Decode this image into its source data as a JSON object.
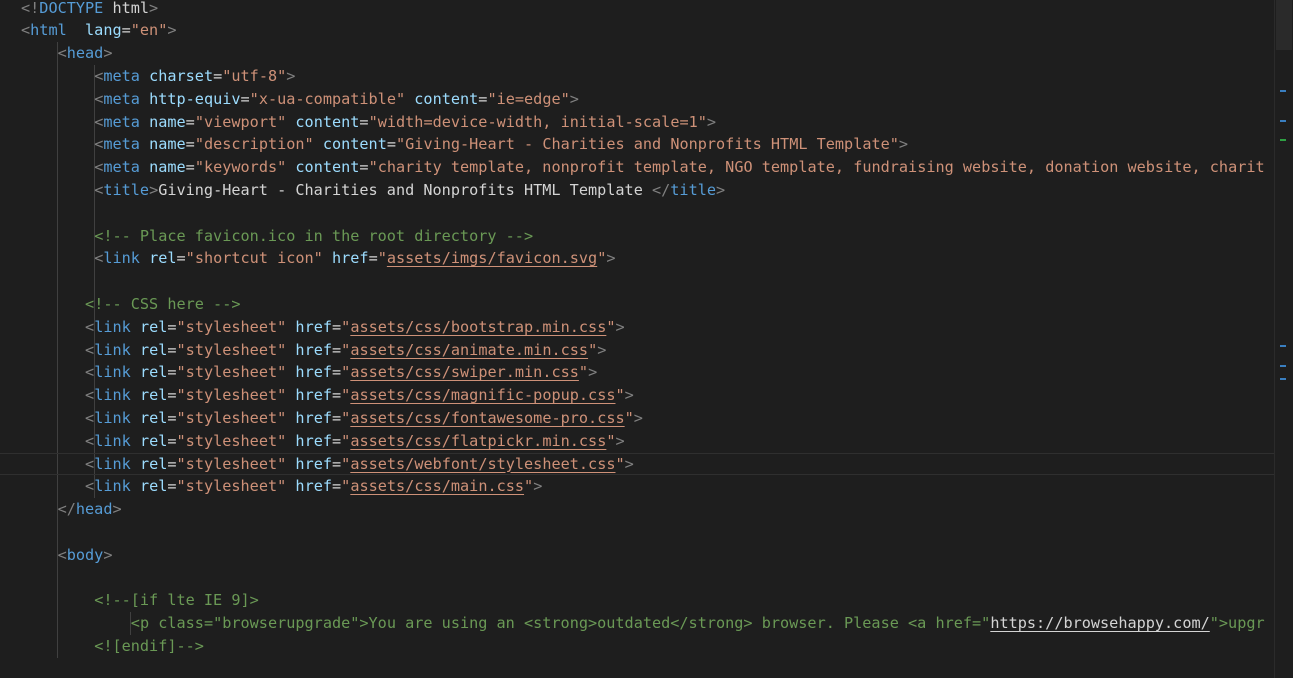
{
  "editor": {
    "current_line": 20,
    "colors": {
      "background": "#1e1e1e",
      "punctuation": "#808080",
      "tag": "#569cd6",
      "attribute": "#9cdcfe",
      "string": "#ce9178",
      "text": "#d4d4d4",
      "comment": "#6a9955"
    },
    "lines": [
      {
        "indent": 0,
        "tokens": [
          [
            "punct",
            "<!"
          ],
          [
            "kw",
            "DOCTYPE"
          ],
          [
            "text",
            " "
          ],
          [
            "docname",
            "html"
          ],
          [
            "punct",
            ">"
          ]
        ]
      },
      {
        "indent": 0,
        "tokens": [
          [
            "punct",
            "<"
          ],
          [
            "tag",
            "html"
          ],
          [
            "text",
            "  "
          ],
          [
            "attr",
            "lang"
          ],
          [
            "text",
            "="
          ],
          [
            "str",
            "\"en\""
          ],
          [
            "punct",
            ">"
          ]
        ]
      },
      {
        "indent": 4,
        "tokens": [
          [
            "punct",
            "<"
          ],
          [
            "tag",
            "head"
          ],
          [
            "punct",
            ">"
          ]
        ]
      },
      {
        "indent": 8,
        "tokens": [
          [
            "punct",
            "<"
          ],
          [
            "tag",
            "meta"
          ],
          [
            "text",
            " "
          ],
          [
            "attr",
            "charset"
          ],
          [
            "text",
            "="
          ],
          [
            "str",
            "\"utf-8\""
          ],
          [
            "punct",
            ">"
          ]
        ]
      },
      {
        "indent": 8,
        "tokens": [
          [
            "punct",
            "<"
          ],
          [
            "tag",
            "meta"
          ],
          [
            "text",
            " "
          ],
          [
            "attr",
            "http-equiv"
          ],
          [
            "text",
            "="
          ],
          [
            "str",
            "\"x-ua-compatible\""
          ],
          [
            "text",
            " "
          ],
          [
            "attr",
            "content"
          ],
          [
            "text",
            "="
          ],
          [
            "str",
            "\"ie=edge\""
          ],
          [
            "punct",
            ">"
          ]
        ]
      },
      {
        "indent": 8,
        "tokens": [
          [
            "punct",
            "<"
          ],
          [
            "tag",
            "meta"
          ],
          [
            "text",
            " "
          ],
          [
            "attr",
            "name"
          ],
          [
            "text",
            "="
          ],
          [
            "str",
            "\"viewport\""
          ],
          [
            "text",
            " "
          ],
          [
            "attr",
            "content"
          ],
          [
            "text",
            "="
          ],
          [
            "str",
            "\"width=device-width, initial-scale=1\""
          ],
          [
            "punct",
            ">"
          ]
        ]
      },
      {
        "indent": 8,
        "tokens": [
          [
            "punct",
            "<"
          ],
          [
            "tag",
            "meta"
          ],
          [
            "text",
            " "
          ],
          [
            "attr",
            "name"
          ],
          [
            "text",
            "="
          ],
          [
            "str",
            "\"description\""
          ],
          [
            "text",
            " "
          ],
          [
            "attr",
            "content"
          ],
          [
            "text",
            "="
          ],
          [
            "str",
            "\"Giving-Heart - Charities and Nonprofits HTML Template\""
          ],
          [
            "punct",
            ">"
          ]
        ]
      },
      {
        "indent": 8,
        "tokens": [
          [
            "punct",
            "<"
          ],
          [
            "tag",
            "meta"
          ],
          [
            "text",
            " "
          ],
          [
            "attr",
            "name"
          ],
          [
            "text",
            "="
          ],
          [
            "str",
            "\"keywords\""
          ],
          [
            "text",
            " "
          ],
          [
            "attr",
            "content"
          ],
          [
            "text",
            "="
          ],
          [
            "str",
            "\"charity template, nonprofit template, NGO template, fundraising website, donation website, charit"
          ]
        ]
      },
      {
        "indent": 8,
        "tokens": [
          [
            "punct",
            "<"
          ],
          [
            "tag",
            "title"
          ],
          [
            "punct",
            ">"
          ],
          [
            "text",
            "Giving-Heart - Charities and Nonprofits HTML Template "
          ],
          [
            "punct",
            "</"
          ],
          [
            "tag",
            "title"
          ],
          [
            "punct",
            ">"
          ]
        ]
      },
      {
        "indent": 0,
        "tokens": []
      },
      {
        "indent": 8,
        "tokens": [
          [
            "comment",
            "<!-- Place favicon.ico in the root directory -->"
          ]
        ]
      },
      {
        "indent": 8,
        "tokens": [
          [
            "punct",
            "<"
          ],
          [
            "tag",
            "link"
          ],
          [
            "text",
            " "
          ],
          [
            "attr",
            "rel"
          ],
          [
            "text",
            "="
          ],
          [
            "str",
            "\"shortcut icon\""
          ],
          [
            "text",
            " "
          ],
          [
            "attr",
            "href"
          ],
          [
            "text",
            "="
          ],
          [
            "str",
            "\""
          ],
          [
            "link",
            "assets/imgs/favicon.svg"
          ],
          [
            "str",
            "\""
          ],
          [
            "punct",
            ">"
          ]
        ]
      },
      {
        "indent": 0,
        "tokens": []
      },
      {
        "indent": 7,
        "tokens": [
          [
            "comment",
            "<!-- CSS here -->"
          ]
        ]
      },
      {
        "indent": 7,
        "tokens": [
          [
            "punct",
            "<"
          ],
          [
            "tag",
            "link"
          ],
          [
            "text",
            " "
          ],
          [
            "attr",
            "rel"
          ],
          [
            "text",
            "="
          ],
          [
            "str",
            "\"stylesheet\""
          ],
          [
            "text",
            " "
          ],
          [
            "attr",
            "href"
          ],
          [
            "text",
            "="
          ],
          [
            "str",
            "\""
          ],
          [
            "link",
            "assets/css/bootstrap.min.css"
          ],
          [
            "str",
            "\""
          ],
          [
            "punct",
            ">"
          ]
        ]
      },
      {
        "indent": 7,
        "tokens": [
          [
            "punct",
            "<"
          ],
          [
            "tag",
            "link"
          ],
          [
            "text",
            " "
          ],
          [
            "attr",
            "rel"
          ],
          [
            "text",
            "="
          ],
          [
            "str",
            "\"stylesheet\""
          ],
          [
            "text",
            " "
          ],
          [
            "attr",
            "href"
          ],
          [
            "text",
            "="
          ],
          [
            "str",
            "\""
          ],
          [
            "link",
            "assets/css/animate.min.css"
          ],
          [
            "str",
            "\""
          ],
          [
            "punct",
            ">"
          ]
        ]
      },
      {
        "indent": 7,
        "tokens": [
          [
            "punct",
            "<"
          ],
          [
            "tag",
            "link"
          ],
          [
            "text",
            " "
          ],
          [
            "attr",
            "rel"
          ],
          [
            "text",
            "="
          ],
          [
            "str",
            "\"stylesheet\""
          ],
          [
            "text",
            " "
          ],
          [
            "attr",
            "href"
          ],
          [
            "text",
            "="
          ],
          [
            "str",
            "\""
          ],
          [
            "link",
            "assets/css/swiper.min.css"
          ],
          [
            "str",
            "\""
          ],
          [
            "punct",
            ">"
          ]
        ]
      },
      {
        "indent": 7,
        "tokens": [
          [
            "punct",
            "<"
          ],
          [
            "tag",
            "link"
          ],
          [
            "text",
            " "
          ],
          [
            "attr",
            "rel"
          ],
          [
            "text",
            "="
          ],
          [
            "str",
            "\"stylesheet\""
          ],
          [
            "text",
            " "
          ],
          [
            "attr",
            "href"
          ],
          [
            "text",
            "="
          ],
          [
            "str",
            "\""
          ],
          [
            "link",
            "assets/css/magnific-popup.css"
          ],
          [
            "str",
            "\""
          ],
          [
            "punct",
            ">"
          ]
        ]
      },
      {
        "indent": 7,
        "tokens": [
          [
            "punct",
            "<"
          ],
          [
            "tag",
            "link"
          ],
          [
            "text",
            " "
          ],
          [
            "attr",
            "rel"
          ],
          [
            "text",
            "="
          ],
          [
            "str",
            "\"stylesheet\""
          ],
          [
            "text",
            " "
          ],
          [
            "attr",
            "href"
          ],
          [
            "text",
            "="
          ],
          [
            "str",
            "\""
          ],
          [
            "link",
            "assets/css/fontawesome-pro.css"
          ],
          [
            "str",
            "\""
          ],
          [
            "punct",
            ">"
          ]
        ]
      },
      {
        "indent": 7,
        "tokens": [
          [
            "punct",
            "<"
          ],
          [
            "tag",
            "link"
          ],
          [
            "text",
            " "
          ],
          [
            "attr",
            "rel"
          ],
          [
            "text",
            "="
          ],
          [
            "str",
            "\"stylesheet\""
          ],
          [
            "text",
            " "
          ],
          [
            "attr",
            "href"
          ],
          [
            "text",
            "="
          ],
          [
            "str",
            "\""
          ],
          [
            "link",
            "assets/css/flatpickr.min.css"
          ],
          [
            "str",
            "\""
          ],
          [
            "punct",
            ">"
          ]
        ]
      },
      {
        "indent": 7,
        "tokens": [
          [
            "punct",
            "<"
          ],
          [
            "tag",
            "link"
          ],
          [
            "text",
            " "
          ],
          [
            "attr",
            "rel"
          ],
          [
            "text",
            "="
          ],
          [
            "str",
            "\"stylesheet\""
          ],
          [
            "text",
            " "
          ],
          [
            "attr",
            "href"
          ],
          [
            "text",
            "="
          ],
          [
            "str",
            "\""
          ],
          [
            "link",
            "assets/webfont/stylesheet.css"
          ],
          [
            "str",
            "\""
          ],
          [
            "punct",
            ">"
          ]
        ]
      },
      {
        "indent": 7,
        "tokens": [
          [
            "punct",
            "<"
          ],
          [
            "tag",
            "link"
          ],
          [
            "text",
            " "
          ],
          [
            "attr",
            "rel"
          ],
          [
            "text",
            "="
          ],
          [
            "str",
            "\"stylesheet\""
          ],
          [
            "text",
            " "
          ],
          [
            "attr",
            "href"
          ],
          [
            "text",
            "="
          ],
          [
            "str",
            "\""
          ],
          [
            "link",
            "assets/css/main.css"
          ],
          [
            "str",
            "\""
          ],
          [
            "punct",
            ">"
          ]
        ]
      },
      {
        "indent": 4,
        "tokens": [
          [
            "punct",
            "</"
          ],
          [
            "tag",
            "head"
          ],
          [
            "punct",
            ">"
          ]
        ]
      },
      {
        "indent": 0,
        "tokens": []
      },
      {
        "indent": 4,
        "tokens": [
          [
            "punct",
            "<"
          ],
          [
            "tag",
            "body"
          ],
          [
            "punct",
            ">"
          ]
        ]
      },
      {
        "indent": 0,
        "tokens": []
      },
      {
        "indent": 8,
        "tokens": [
          [
            "comment",
            "<!--[if lte IE 9]>"
          ]
        ]
      },
      {
        "indent": 12,
        "tokens": [
          [
            "comment",
            "<p class=\"browserupgrade\">You are using an <strong>outdated</strong> browser. Please <a href=\""
          ],
          [
            "linkc",
            "https://browsehappy.com/"
          ],
          [
            "comment",
            "\">upgr"
          ]
        ]
      },
      {
        "indent": 8,
        "tokens": [
          [
            "comment",
            "<![endif]-->"
          ]
        ]
      }
    ]
  }
}
